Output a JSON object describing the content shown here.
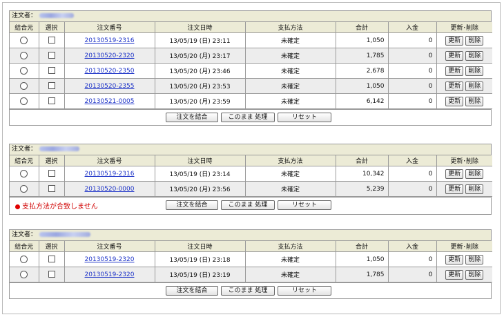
{
  "labels": {
    "orderer": "注文者：",
    "columns": [
      "結合元",
      "選択",
      "注文番号",
      "注文日時",
      "支払方法",
      "合計",
      "入金",
      "更新･削除"
    ],
    "update": "更新",
    "delete": "削除",
    "merge": "注文を結合",
    "process": "このまま 処理",
    "reset": "リセット"
  },
  "groups": [
    {
      "rows": [
        {
          "order": "20130519-2316",
          "date": "13/05/19 (日) 23:11",
          "pay": "未確定",
          "total": "1,050",
          "paid": "0"
        },
        {
          "order": "20130520-2320",
          "date": "13/05/20 (月) 23:17",
          "pay": "未確定",
          "total": "1,785",
          "paid": "0"
        },
        {
          "order": "20130520-2350",
          "date": "13/05/20 (月) 23:46",
          "pay": "未確定",
          "total": "2,678",
          "paid": "0"
        },
        {
          "order": "20130520-2355",
          "date": "13/05/20 (月) 23:53",
          "pay": "未確定",
          "total": "1,050",
          "paid": "0"
        },
        {
          "order": "20130521-0005",
          "date": "13/05/20 (月) 23:59",
          "pay": "未確定",
          "total": "6,142",
          "paid": "0"
        }
      ]
    },
    {
      "error": "支払方法が合致しません",
      "rows": [
        {
          "order": "20130519-2316",
          "date": "13/05/19 (日) 23:14",
          "pay": "未確定",
          "total": "10,342",
          "paid": "0"
        },
        {
          "order": "20130520-0000",
          "date": "13/05/20 (月) 23:56",
          "pay": "未確定",
          "total": "5,239",
          "paid": "0"
        }
      ]
    },
    {
      "rows": [
        {
          "order": "20130519-2320",
          "date": "13/05/19 (日) 23:18",
          "pay": "未確定",
          "total": "1,050",
          "paid": "0"
        },
        {
          "order": "20130519-2320",
          "date": "13/05/19 (日) 23:19",
          "pay": "未確定",
          "total": "1,785",
          "paid": "0"
        }
      ]
    }
  ]
}
